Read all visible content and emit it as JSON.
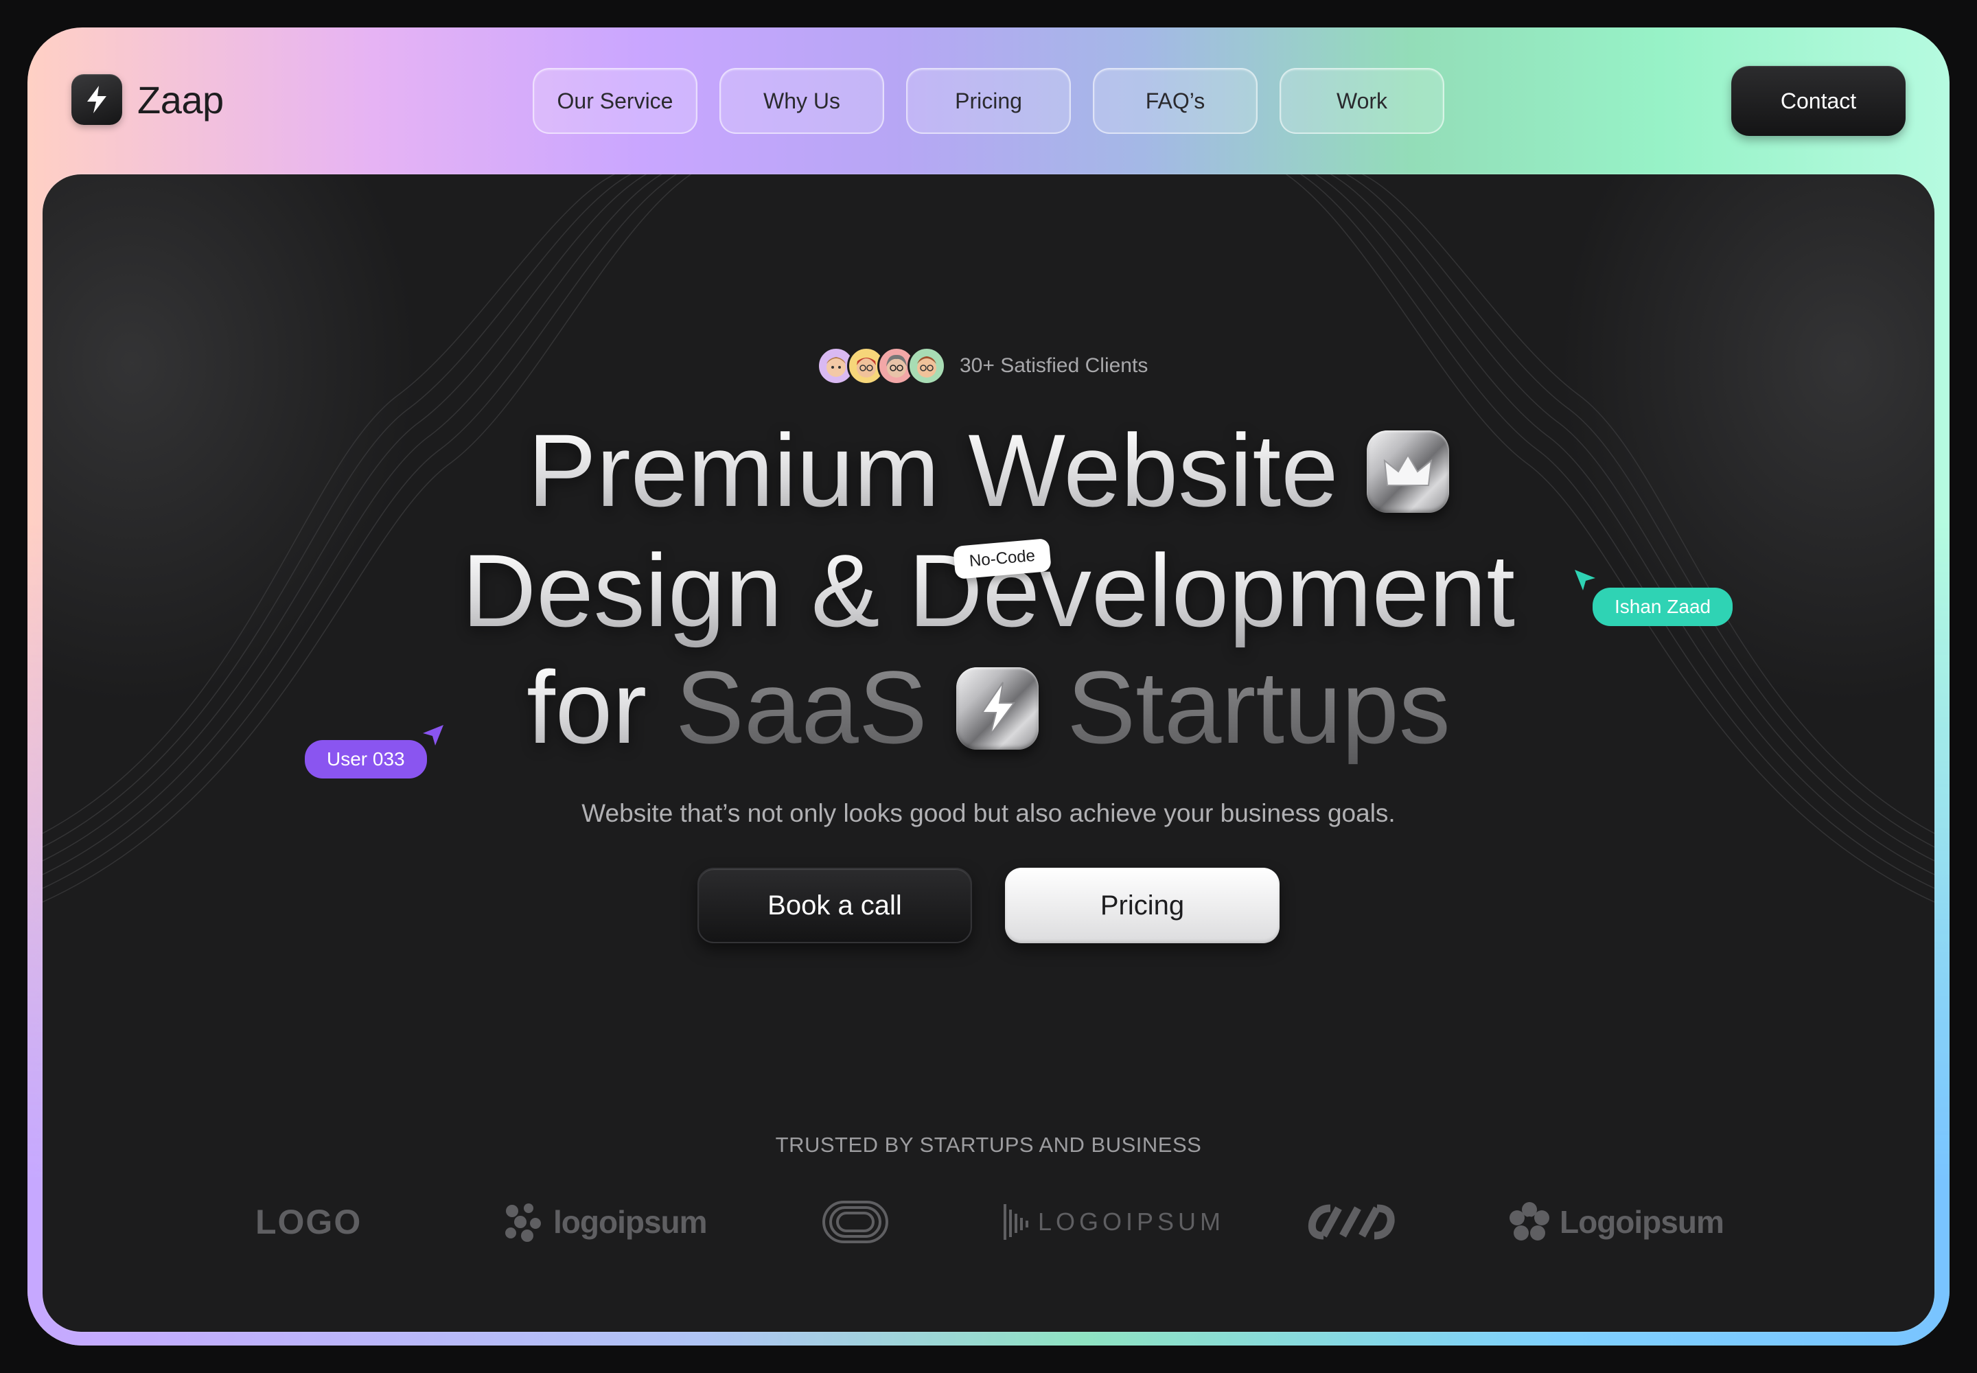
{
  "brand": {
    "name": "Zaap",
    "icon": "lightning-icon"
  },
  "nav": {
    "items": [
      {
        "label": "Our Service"
      },
      {
        "label": "Why Us"
      },
      {
        "label": "Pricing"
      },
      {
        "label": "FAQ’s"
      },
      {
        "label": "Work"
      }
    ],
    "contact_label": "Contact"
  },
  "hero": {
    "clients_text": "30+ Satisfied Clients",
    "headline": {
      "line1": "Premium Website",
      "line2": "Design & Development",
      "line3_prefix": "for",
      "line3_word1": "SaaS",
      "line3_word2": "Startups"
    },
    "tag_nocode": "No-Code",
    "cursor_right_label": "Ishan Zaad",
    "cursor_left_label": "User 033",
    "subtitle": "Website that’s not only looks good but also achieve your business goals.",
    "primary_button": "Book a call",
    "secondary_button": "Pricing"
  },
  "trusted": {
    "heading": "TRUSTED BY  STARTUPS AND BUSINESS",
    "logos": [
      "LOGO",
      "logoipsum",
      "",
      "LOGOIPSUM",
      "",
      "Logoipsum"
    ]
  },
  "colors": {
    "cursor_right": "#2fd3b4",
    "cursor_left": "#8a55f0",
    "panel_bg": "#1c1c1d"
  }
}
